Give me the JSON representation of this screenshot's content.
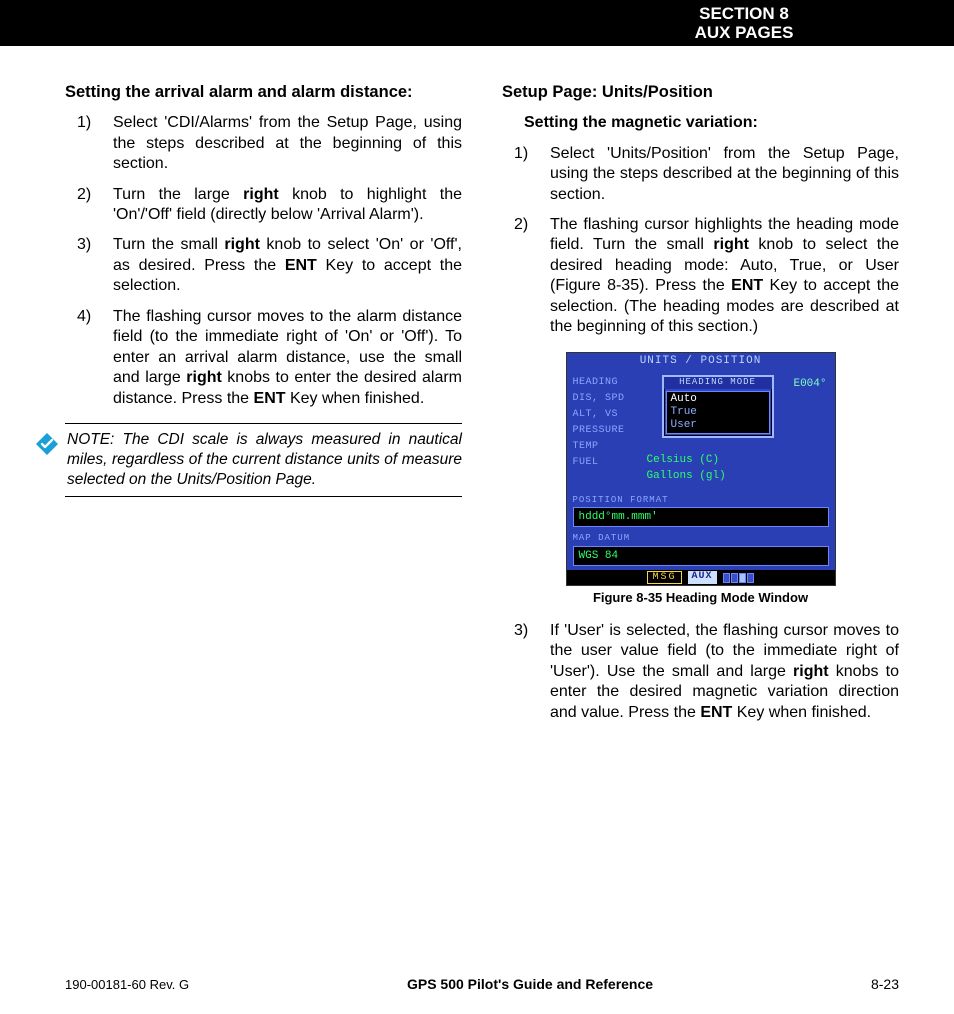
{
  "header": {
    "line1": "SECTION 8",
    "line2": "AUX PAGES"
  },
  "left": {
    "heading": "Setting the arrival alarm and alarm distance:",
    "steps": [
      {
        "n": "1)",
        "t": "Select 'CDI/Alarms' from the Setup Page, using the steps described at the beginning of this section."
      },
      {
        "n": "2)",
        "t": "Turn the large <b>right</b> knob to highlight the 'On'/'Off' field (directly below 'Arrival Alarm')."
      },
      {
        "n": "3)",
        "t": "Turn the small <b>right</b> knob to select 'On' or 'Off', as desired.  Press the <b>ENT</b> Key to accept the selection."
      },
      {
        "n": "4)",
        "t": "The flashing cursor moves to the alarm distance field (to the immediate right of 'On' or 'Off').  To enter an arrival alarm distance, use the small and large <b>right</b> knobs to enter the desired alarm distance.  Press the <b>ENT</b> Key when finished."
      }
    ],
    "note": "NOTE:  The CDI scale is always measured in nautical miles, regardless of the current distance units of measure selected on the Units/Position Page."
  },
  "right": {
    "heading": "Setup Page: Units/Position",
    "subheading": "Setting the magnetic variation:",
    "steps_a": [
      {
        "n": "1)",
        "t": "Select 'Units/Position' from the Setup Page, using the steps described at the beginning of this section."
      },
      {
        "n": "2)",
        "t": "The flashing cursor highlights the heading mode field.  Turn the small <b>right</b> knob to select the desired heading mode: Auto, True, or User (Figure 8-35).  Press the <b>ENT</b> Key to accept the selection.  (The heading modes are described at the beginning of this section.)"
      }
    ],
    "figure": {
      "screen_title": "UNITS / POSITION",
      "rows": [
        "HEADING",
        "DIS, SPD",
        "ALT, VS",
        "PRESSURE",
        "TEMP",
        "FUEL"
      ],
      "deg": "E004°",
      "popup_title": "HEADING MODE",
      "popup_options": [
        "Auto",
        "True",
        "User"
      ],
      "temp_val": "Celsius (C)",
      "fuel_val": "Gallons (gl)",
      "pos_label": "POSITION FORMAT",
      "pos_val": "hddd°mm.mmm'",
      "datum_label": "MAP DATUM",
      "datum_val": "WGS 84",
      "status_msg": "MSG",
      "status_aux": "AUX",
      "caption": "Figure 8-35  Heading Mode Window"
    },
    "steps_b": [
      {
        "n": "3)",
        "t": "If 'User' is selected, the flashing cursor moves to the user value field (to the immediate right of 'User').  Use the small and large <b>right</b> knobs to enter the desired magnetic variation direction and value.  Press the <b>ENT</b> Key when finished."
      }
    ]
  },
  "footer": {
    "left": "190-00181-60  Rev. G",
    "center": "GPS 500 Pilot's Guide and Reference",
    "right": "8-23"
  }
}
